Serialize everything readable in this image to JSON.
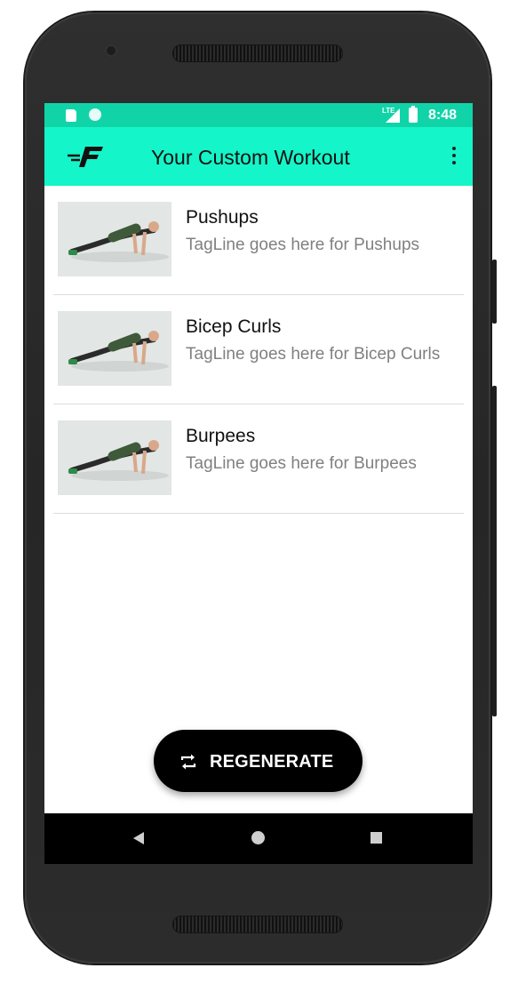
{
  "status_bar": {
    "network": "LTE",
    "time": "8:48",
    "icons": [
      "sd-card-icon",
      "sync-circle-icon",
      "signal-icon",
      "battery-charging-icon"
    ]
  },
  "app_bar": {
    "logo_icon": "brand-f-logo-icon",
    "title": "Your Custom Workout",
    "menu_icon": "more-vert-icon"
  },
  "workouts": [
    {
      "title": "Pushups",
      "tagline": "TagLine goes here for Pushups",
      "image": "pushup-photo"
    },
    {
      "title": "Bicep Curls",
      "tagline": "TagLine goes here for Bicep Curls",
      "image": "pushup-photo"
    },
    {
      "title": "Burpees",
      "tagline": "TagLine goes here for Burpees",
      "image": "pushup-photo"
    }
  ],
  "fab": {
    "label": "REGENERATE",
    "icon": "repeat-icon"
  },
  "nav_bar": {
    "icons": [
      "back-icon",
      "home-icon",
      "recents-icon"
    ]
  },
  "colors": {
    "status_bar": "#10d4a8",
    "app_bar": "#14f5c9",
    "fab": "#000000",
    "tagline": "#808080"
  }
}
